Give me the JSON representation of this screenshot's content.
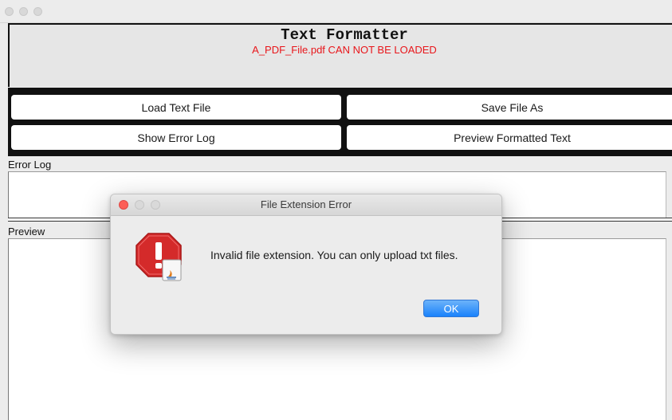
{
  "app": {
    "title": "Text Formatter",
    "status_message": "A_PDF_File.pdf CAN NOT BE LOADED"
  },
  "buttons": {
    "load_text_file": "Load Text File",
    "save_file_as": "Save File As",
    "show_error_log": "Show  Error Log",
    "preview_formatted_text": "Preview Formatted Text"
  },
  "sections": {
    "error_log_label": "Error Log",
    "preview_label": "Preview"
  },
  "dialog": {
    "title": "File Extension Error",
    "message": "Invalid file extension. You can only upload txt files.",
    "ok_label": "OK",
    "icon": "stop-alert-icon"
  },
  "colors": {
    "status_text": "#e8161b",
    "ok_button": "#1a82fb",
    "close_dot": "#fc5f57",
    "alert_red": "#d42a2a"
  }
}
